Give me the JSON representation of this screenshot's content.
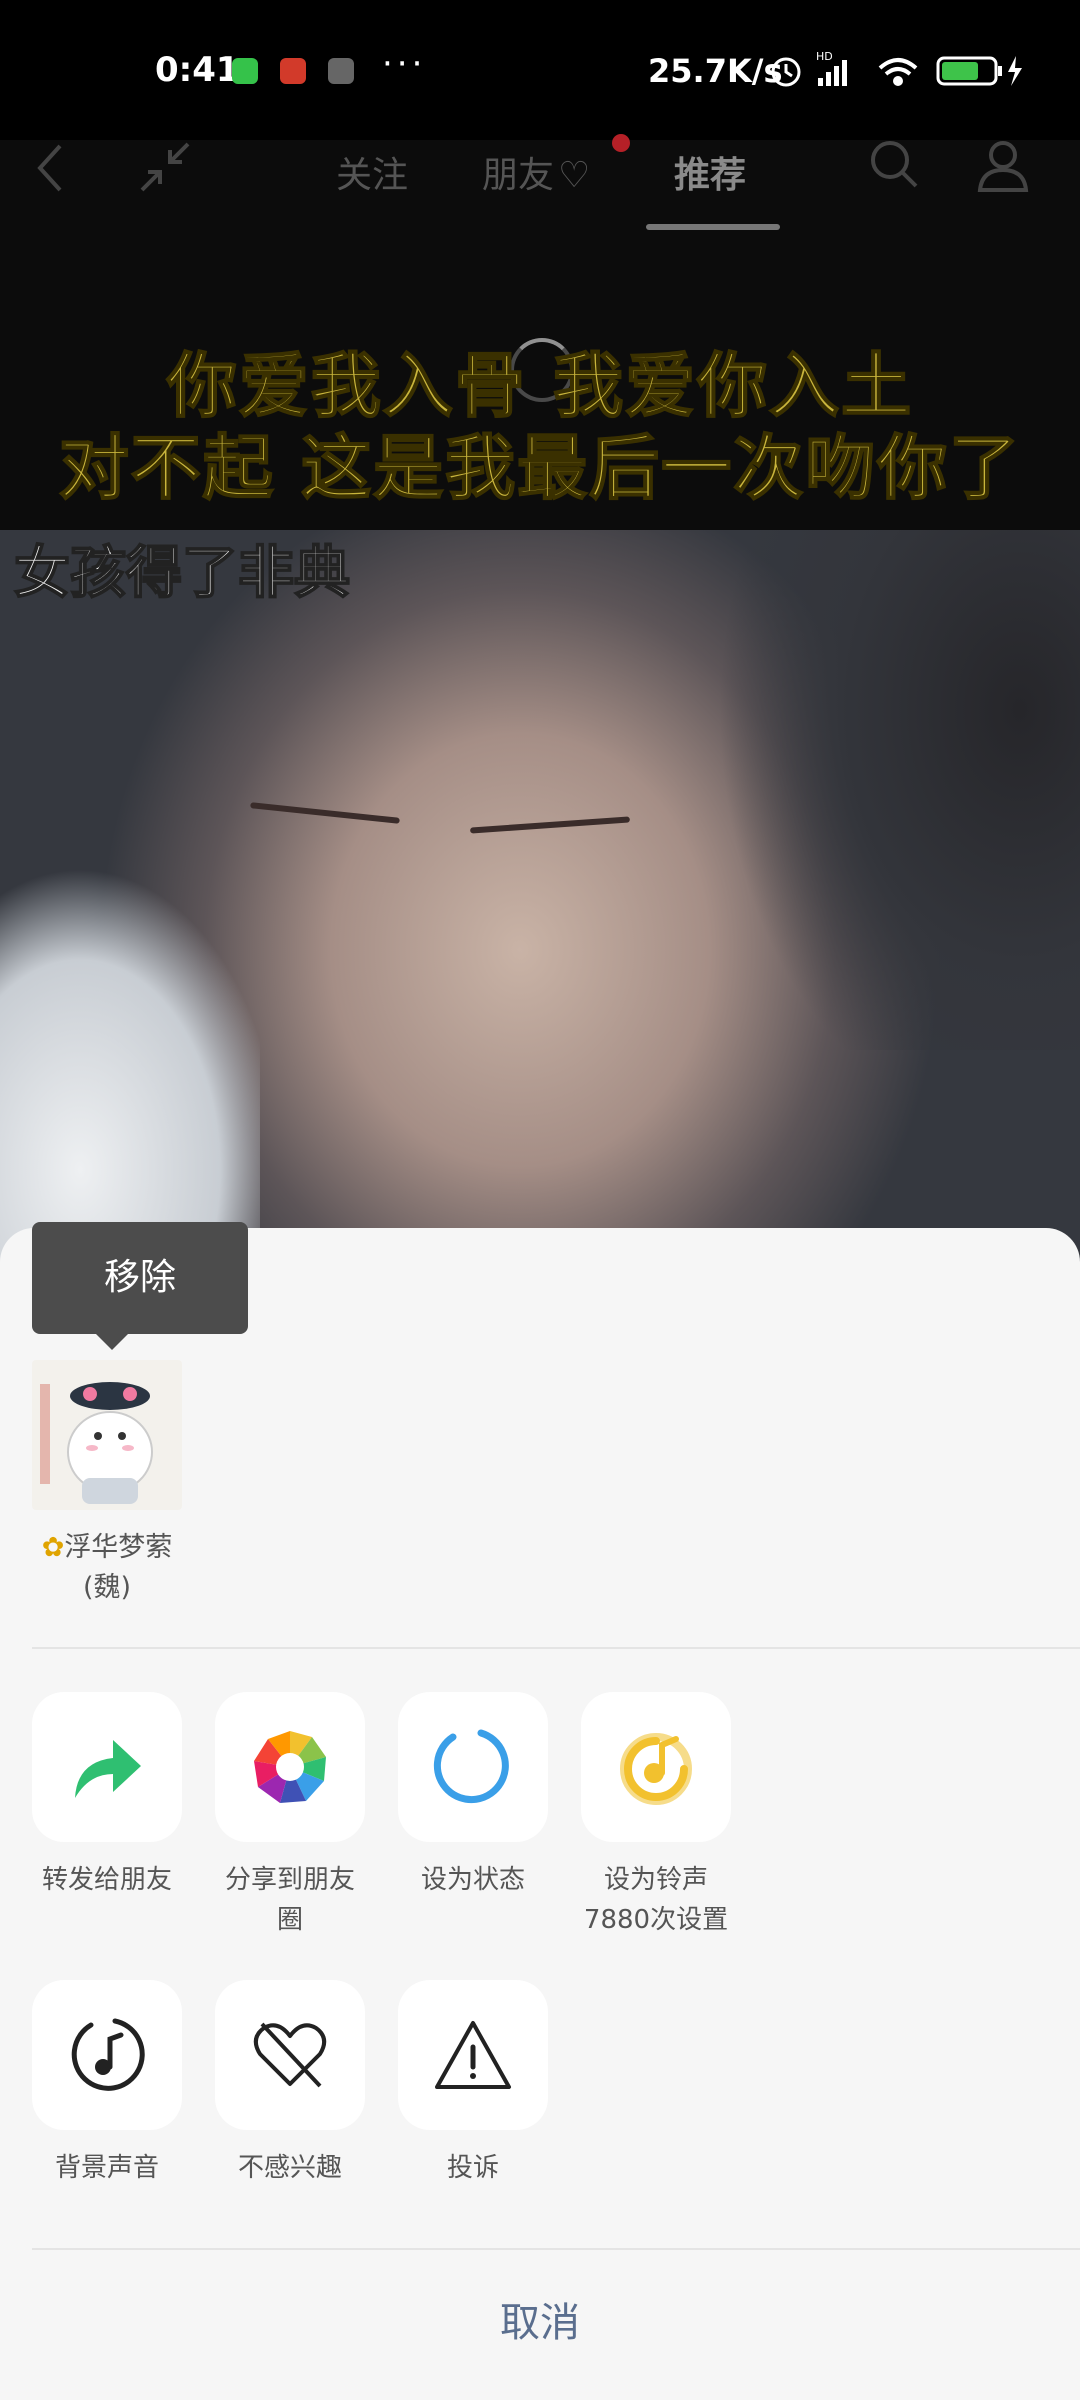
{
  "status_bar": {
    "time": "0:41",
    "dots": "···",
    "net_speed": "25.7K/s",
    "network": "HD",
    "battery": "65"
  },
  "nav": {
    "tabs": [
      "关注",
      "朋友",
      "推荐"
    ],
    "active_tab": "推荐"
  },
  "video": {
    "caption_line1": "你爱我入骨 我爱你入土",
    "caption_line2": "对不起 这是我最后一次吻你了",
    "overlay_text": "女孩得了非典"
  },
  "sheet": {
    "tooltip": "移除",
    "friend": {
      "name_line1": "浮华梦萦",
      "name_line2": "(魏)"
    },
    "actions_row1": [
      {
        "label": "转发给朋友",
        "icon": "forward-arrow-icon"
      },
      {
        "label": "分享到朋友圈",
        "icon": "moments-shutter-icon"
      },
      {
        "label": "设为状态",
        "icon": "status-ring-icon"
      },
      {
        "label": "设为铃声",
        "sub": "7880次设置",
        "icon": "ringtone-icon"
      }
    ],
    "actions_row2": [
      {
        "label": "背景声音",
        "icon": "music-note-icon"
      },
      {
        "label": "不感兴趣",
        "icon": "broken-heart-icon"
      },
      {
        "label": "投诉",
        "icon": "warning-triangle-icon"
      }
    ],
    "cancel_label": "取消"
  },
  "colors": {
    "accent_green": "#2fbf71",
    "status_blue": "#3a9fe8",
    "ringtone_yellow": "#f2c12e",
    "cancel_text": "#5a6e8e"
  }
}
